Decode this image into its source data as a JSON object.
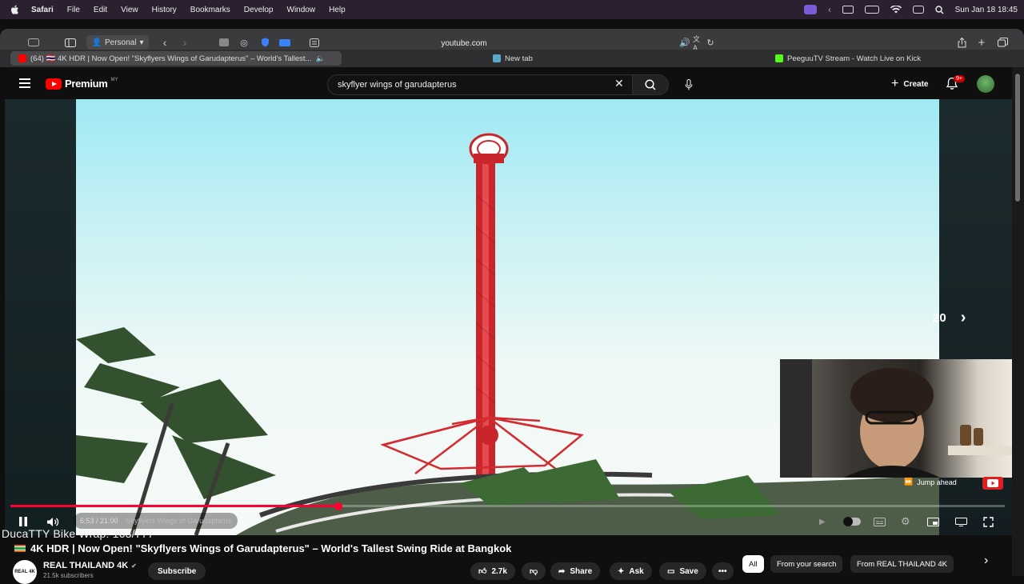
{
  "menubar": {
    "app": "Safari",
    "items": [
      "File",
      "Edit",
      "View",
      "History",
      "Bookmarks",
      "Develop",
      "Window",
      "Help"
    ],
    "datetime": "Sun Jan 18  18:45"
  },
  "toolbar": {
    "profile": "Personal",
    "url": "youtube.com"
  },
  "tabs": [
    {
      "label": "(64) 🇹🇭 4K HDR | Now Open! \"Skyflyers Wings of Garudapterus\" – World's Tallest...",
      "active": true
    },
    {
      "label": "New tab",
      "active": false
    },
    {
      "label": "PeeguuTV Stream - Watch Live on Kick",
      "active": false
    }
  ],
  "header": {
    "brand": "Premium",
    "region": "MY",
    "search_value": "skyflyer wings of garudapterus",
    "create_label": "Create",
    "notif_badge": "9+"
  },
  "player": {
    "skip_seconds": "20",
    "jump_ahead": "Jump ahead",
    "time": "6:53 / 21:00",
    "chapter": "Skyflyers Wings of Garudaptarus",
    "progress_fraction": 0.33,
    "overlay_text": "DucaTTY Bike Wrap: 163/777"
  },
  "video_info": {
    "title": "4K HDR | Now Open! \"Skyflyers Wings of Garudapterus\" – World's Tallest Swing Ride at Bangkok",
    "channel": "REAL THAILAND 4K",
    "channel_logo_text": "REAL 4K",
    "subscribers": "21.5k subscribers",
    "subscribe_label": "Subscribe",
    "likes": "2.7k",
    "share_label": "Share",
    "ask_label": "Ask",
    "save_label": "Save"
  },
  "chips": [
    "All",
    "From your search",
    "From REAL THAILAND 4K"
  ],
  "colors": {
    "accent": "#ff0033",
    "brand_red": "#ff0000",
    "sky": "#9fe9f4",
    "tower_red": "#c8262b"
  }
}
